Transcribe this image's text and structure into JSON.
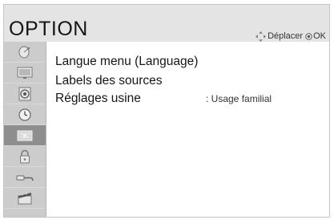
{
  "header": {
    "title": "OPTION",
    "move_hint": "Déplacer",
    "ok_hint": "OK"
  },
  "sidebar": {
    "items": [
      {
        "icon": "satellite-dish-icon",
        "active": false
      },
      {
        "icon": "picture-icon",
        "active": false
      },
      {
        "icon": "audio-icon",
        "active": false
      },
      {
        "icon": "clock-icon",
        "active": false
      },
      {
        "icon": "option-icon",
        "active": true
      },
      {
        "icon": "lock-icon",
        "active": false
      },
      {
        "icon": "input-icon",
        "active": false
      },
      {
        "icon": "media-icon",
        "active": false
      }
    ]
  },
  "menu": {
    "items": [
      {
        "label": "Langue menu (Language)",
        "value": ""
      },
      {
        "label": "Labels des sources",
        "value": ""
      },
      {
        "label": "Réglages usine",
        "value": ": Usage familial"
      }
    ]
  },
  "colors": {
    "header_bg": "#e4e4e4",
    "sidebar_bg": "#cccccc",
    "active_item_bg": "#8e8e8e",
    "text": "#161616"
  }
}
